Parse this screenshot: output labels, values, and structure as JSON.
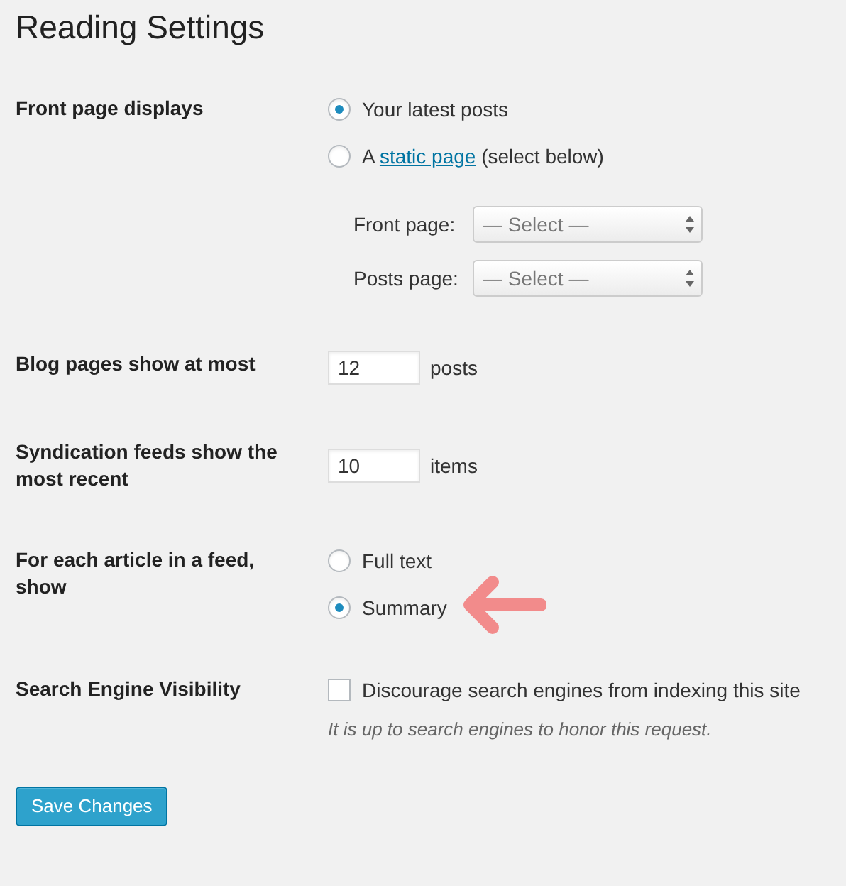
{
  "title": "Reading Settings",
  "settings": [
    {
      "kind": "radios",
      "label": "Front page displays",
      "options": [
        {
          "label": "Your latest posts",
          "selected": true,
          "marked": false
        },
        {
          "label": "A",
          "link": "static page",
          "suffix": "(select below)",
          "selected": false,
          "marked": false
        }
      ],
      "selects": [
        {
          "label": "Front page:",
          "value": "— Select —"
        },
        {
          "label": "Posts page:",
          "value": "— Select —"
        }
      ]
    },
    {
      "kind": "number",
      "label": "Blog pages show at most",
      "value": "12",
      "unit": "posts"
    },
    {
      "kind": "number",
      "label": "Syndication feeds show the most recent",
      "value": "10",
      "unit": "items"
    },
    {
      "kind": "radios",
      "label": "For each article in a feed, show",
      "options": [
        {
          "label": "Full text",
          "selected": false,
          "marked": false
        },
        {
          "label": "Summary",
          "selected": true,
          "marked": true
        }
      ]
    },
    {
      "kind": "checkbox",
      "label": "Search Engine Visibility",
      "option": "Discourage search engines from indexing this site",
      "checked": false,
      "description": "It is up to search engines to honor this request."
    }
  ],
  "save_button": "Save Changes"
}
